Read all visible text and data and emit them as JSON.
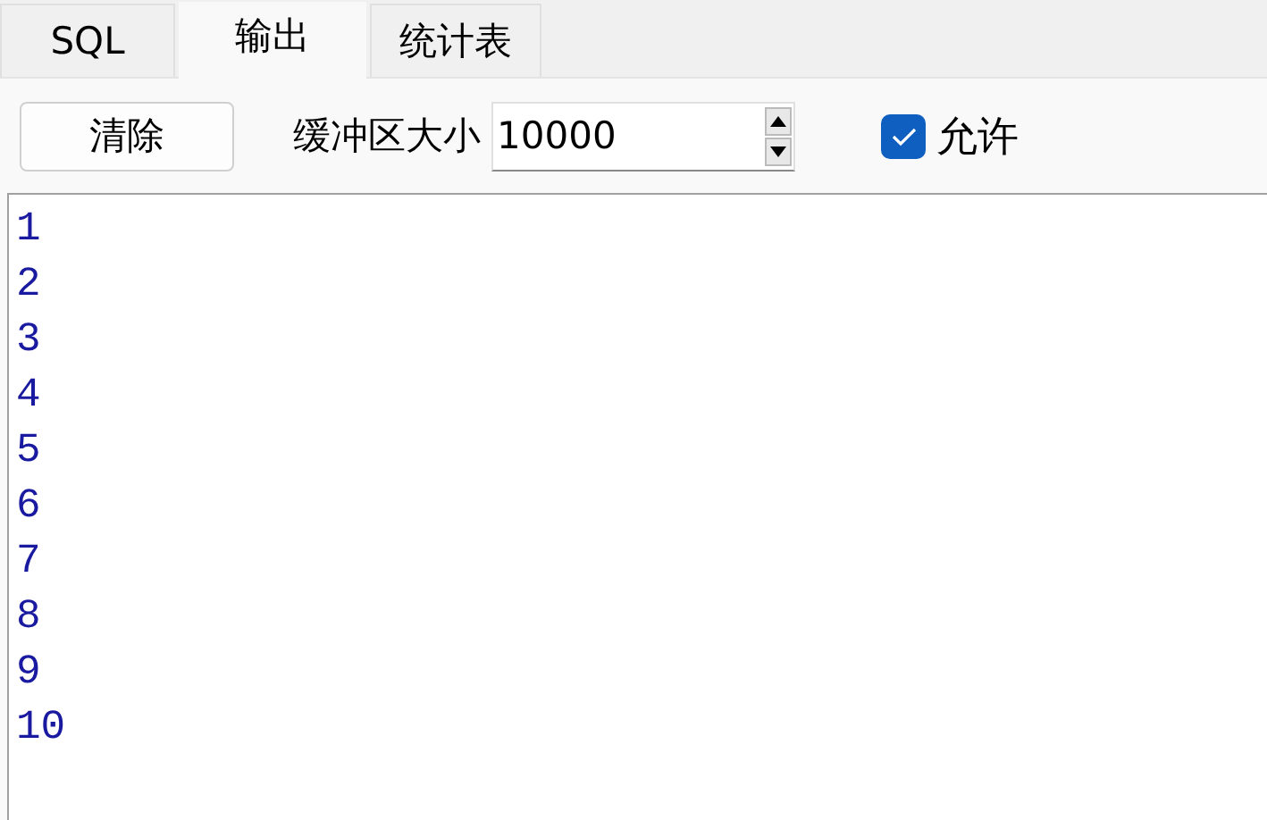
{
  "tabs": [
    {
      "label": "SQL",
      "selected": false
    },
    {
      "label": "输出",
      "selected": true
    },
    {
      "label": "统计表",
      "selected": false
    }
  ],
  "toolbar": {
    "clear_button": "清除",
    "buffer_label": "缓冲区大小",
    "buffer_value": "10000",
    "allow": {
      "label": "允许",
      "checked": true
    }
  },
  "output_lines": [
    "1",
    "2",
    "3",
    "4",
    "5",
    "6",
    "7",
    "8",
    "9",
    "10"
  ]
}
